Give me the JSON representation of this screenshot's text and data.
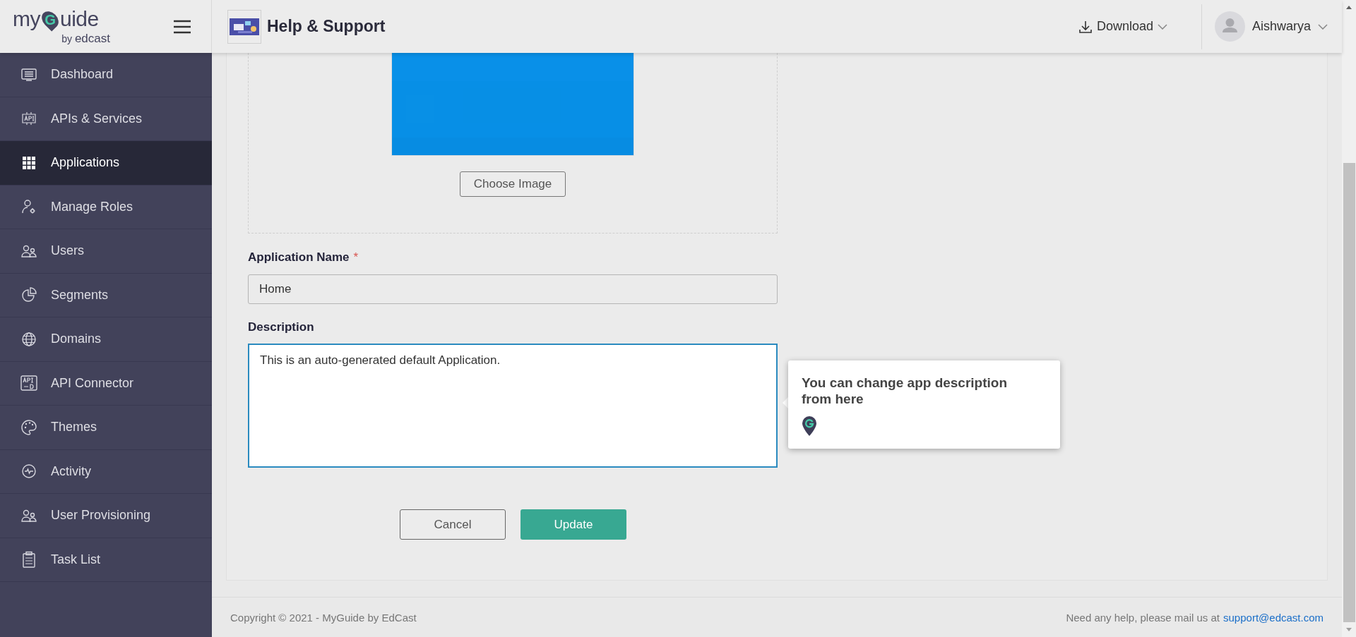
{
  "logo": {
    "before": "my",
    "pin_letter": "G",
    "after": "uide",
    "by": "by",
    "brand": "edcast"
  },
  "header": {
    "title": "Help & Support",
    "download": "Download",
    "user": "Aishwarya"
  },
  "sidebar": {
    "items": [
      {
        "label": "Dashboard",
        "selected": false
      },
      {
        "label": "APIs & Services",
        "selected": false
      },
      {
        "label": "Applications",
        "selected": true
      },
      {
        "label": "Manage Roles",
        "selected": false
      },
      {
        "label": "Users",
        "selected": false
      },
      {
        "label": "Segments",
        "selected": false
      },
      {
        "label": "Domains",
        "selected": false
      },
      {
        "label": "API Connector",
        "selected": false
      },
      {
        "label": "Themes",
        "selected": false
      },
      {
        "label": "Activity",
        "selected": false
      },
      {
        "label": "User Provisioning",
        "selected": false
      },
      {
        "label": "Task List",
        "selected": false
      }
    ]
  },
  "form": {
    "choose_image": "Choose Image",
    "name_label": "Application Name",
    "required_mark": "*",
    "name_value": "Home",
    "description_label": "Description",
    "description_value": "This is an auto-generated default Application.",
    "tooltip": "You can change app description from here",
    "cancel": "Cancel",
    "update": "Update"
  },
  "footer": {
    "copyright": "Copyright © 2021 - MyGuide by EdCast",
    "help": "Need any help, please mail us at",
    "email": "support@edcast.com"
  }
}
